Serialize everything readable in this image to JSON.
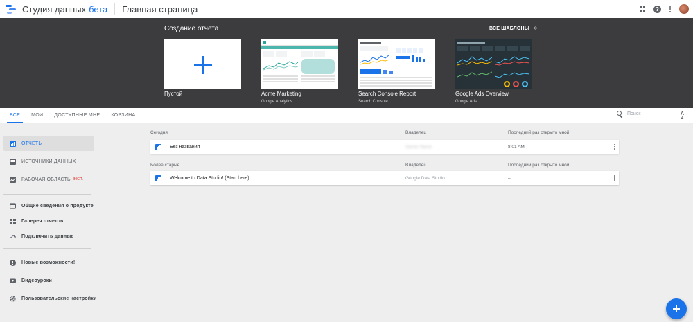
{
  "app": {
    "name": "Студия данных",
    "beta": "бета",
    "page_title": "Главная страница"
  },
  "colors": {
    "accent": "#1a73e8",
    "band_bg": "#3c3c3f",
    "page_bg": "#eeeeee"
  },
  "templates": {
    "title": "Создание отчета",
    "all_templates_label": "ВСЕ ШАБЛОНЫ",
    "items": [
      {
        "name": "Пустой",
        "source": "",
        "icon": "plus-icon"
      },
      {
        "name": "Acme Marketing",
        "source": "Google Analytics"
      },
      {
        "name": "Search Console Report",
        "source": "Search Console"
      },
      {
        "name": "Google Ads Overview",
        "source": "Google Ads"
      }
    ]
  },
  "tabs": [
    {
      "label": "ВСЕ",
      "active": true
    },
    {
      "label": "МОИ",
      "active": false
    },
    {
      "label": "ДОСТУПНЫЕ МНЕ",
      "active": false
    },
    {
      "label": "КОРЗИНА",
      "active": false
    }
  ],
  "search": {
    "placeholder": "Поиск"
  },
  "sort_icon": "sort-az-icon",
  "sidebar": {
    "items": [
      {
        "label": "ОТЧЕТЫ",
        "icon": "reports-icon",
        "active": true
      },
      {
        "label": "ИСТОЧНИКИ ДАННЫХ",
        "icon": "data-sources-icon"
      },
      {
        "label": "РАБОЧАЯ ОБЛАСТЬ",
        "icon": "explorer-icon",
        "badge": "ЭКСП."
      }
    ],
    "links": [
      {
        "label": "Общие сведения о продукте",
        "icon": "overview-icon"
      },
      {
        "label": "Галерея отчетов",
        "icon": "gallery-icon"
      },
      {
        "label": "Подключить данные",
        "icon": "connect-data-icon"
      }
    ],
    "help": [
      {
        "label": "Новые возможности!",
        "icon": "whats-new-icon"
      },
      {
        "label": "Видеоуроки",
        "icon": "video-icon"
      },
      {
        "label": "Пользовательские настройки",
        "icon": "settings-icon"
      }
    ]
  },
  "main": {
    "columns": {
      "owner": "Владелец",
      "last_opened": "Последний раз открыто мной"
    },
    "groups": [
      {
        "label": "Сегодня",
        "rows": [
          {
            "name": "Без названия",
            "owner": "Owner Name",
            "last_opened": "8:01 AM"
          }
        ]
      },
      {
        "label": "Более старые",
        "rows": [
          {
            "name": "Welcome to Data Studio! (Start here)",
            "owner": "Google Data Studio",
            "last_opened": "–"
          }
        ]
      }
    ]
  }
}
